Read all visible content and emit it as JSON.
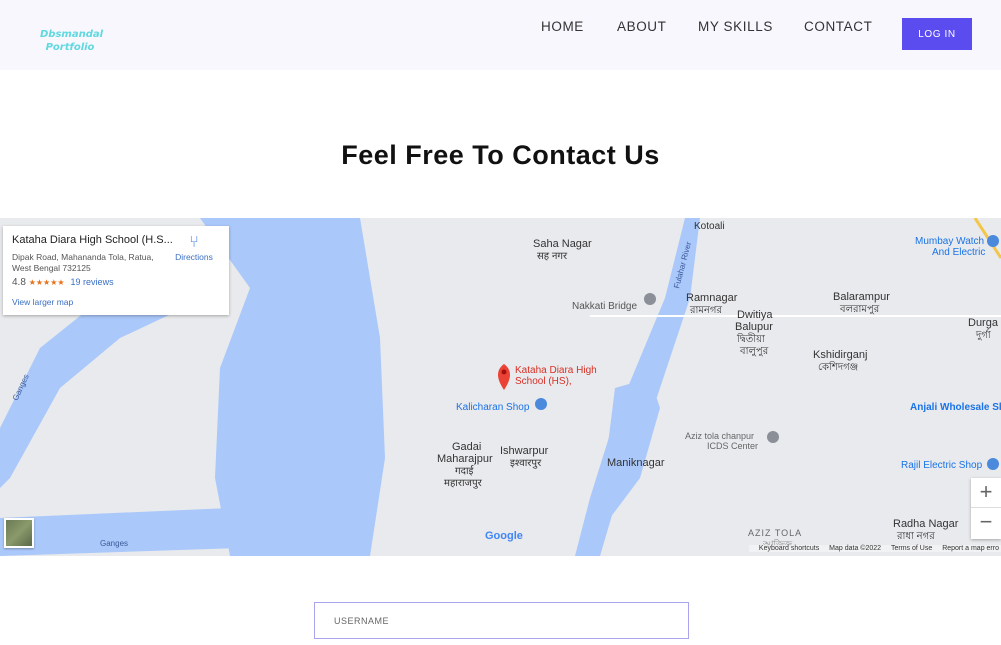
{
  "header": {
    "logo_line1": "Dbsmandal",
    "logo_line2": "Portfolio",
    "nav": [
      "HOME",
      "ABOUT",
      "MY SKILLS",
      "CONTACT"
    ],
    "login": "LOG IN",
    "accent": "#5b4cf0"
  },
  "title": "Feel Free To Contact Us",
  "map": {
    "place_card": {
      "name": "Kataha Diara High School (H.S...",
      "address1": "Dipak Road, Mahananda Tola, Ratua,",
      "address2": "West Bengal 732125",
      "rating": "4.8",
      "stars": "★★★★★",
      "reviews": "19 reviews",
      "directions": "Directions",
      "view_larger": "View larger map"
    },
    "labels": {
      "saha_nagar": "Saha Nagar",
      "saha_nagar_hi": "सह नगर",
      "ramnagar": "Ramnagar",
      "ramnagar_bn": "রামনগর",
      "nakkati": "Nakkati Bridge",
      "dwitiya1": "Dwitiya",
      "dwitiya2": "Balupur",
      "dwitiya_bn1": "দ্বিতীয়া",
      "dwitiya_bn2": "বালুপুর",
      "balarampur": "Balarampur",
      "balarampur_bn": "বলরামপুর",
      "durgapur": "Durga",
      "durgapur_bn": "দুর্গা",
      "mumbay": "Mumbay Watch",
      "mumbay2": "And Electric",
      "pin1": "Kataha Diara High",
      "pin2": "School (HS),",
      "kalicharan": "Kalicharan Shop",
      "kshidirganj": "Kshidirganj",
      "kshidirganj_bn": "কেশিদগঞ্জ",
      "anjali": "Anjali Wholesale Sh",
      "aziz_chanpur": "Aziz tola chanpur",
      "icds": "ICDS Center",
      "gadai1": "Gadai",
      "gadai2": "Maharajpur",
      "gadai_hi1": "गदाई",
      "gadai_hi2": "महाराजपुर",
      "ishwarpur": "Ishwarpur",
      "ishwarpur_hi": "इश्वारपुर",
      "maniknagar": "Maniknagar",
      "rajil": "Rajil Electric Shop",
      "aziz_tola": "AZIZ TOLA",
      "aziz_tola_bn": "আজিজ",
      "radha": "Radha Nagar",
      "radha_bn": "রাধা নগর",
      "ganges1": "Ganges",
      "ganges2": "Ganges",
      "fulahar": "Fulahar River",
      "kotoali": "Kotoali"
    },
    "google": "Google",
    "footer": {
      "shortcuts": "Keyboard shortcuts",
      "data": "Map data ©2022",
      "terms": "Terms of Use",
      "report": "Report a map erro"
    },
    "water_color": "#aac8fa",
    "land_color": "#e8eaed"
  },
  "form": {
    "username_placeholder": "USERNAME"
  }
}
